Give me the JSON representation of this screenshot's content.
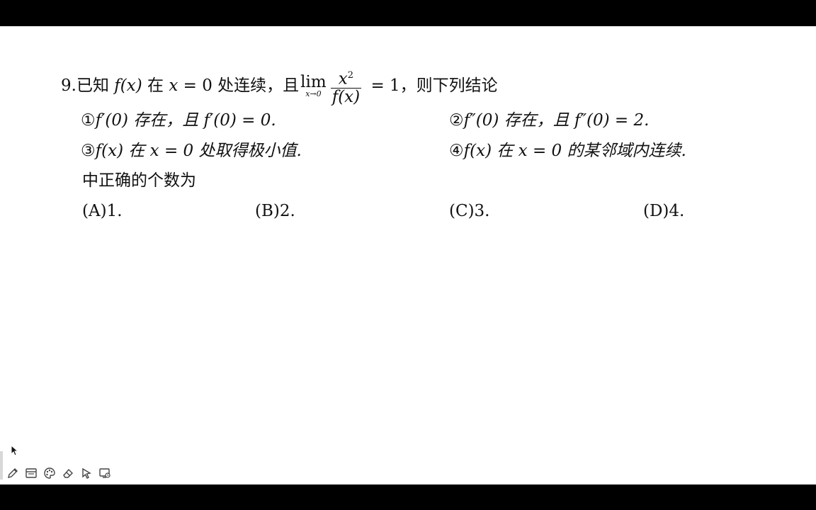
{
  "problem": {
    "number": "9.",
    "stem_1": "已知",
    "fx": "f(x)",
    "stem_2": "在",
    "cond_var": "x",
    "cond_eq": "= 0",
    "stem_3": "处连续，且",
    "lim_word": "lim",
    "lim_sub": "x→0",
    "frac_num": "x",
    "frac_num_exp": "2",
    "frac_den": "f(x)",
    "lim_value": "= 1",
    "stem_4": "，则下列结论"
  },
  "statements": [
    {
      "marker": "①",
      "text": "f′(0) 存在，且 f′(0) = 0."
    },
    {
      "marker": "②",
      "text": "f″(0) 存在，且 f″(0) = 2."
    },
    {
      "marker": "③",
      "text": "f(x) 在 x = 0 处取得极小值."
    },
    {
      "marker": "④",
      "text": "f(x) 在 x = 0 的某邻域内连续."
    }
  ],
  "question_tail": "中正确的个数为",
  "choices": [
    {
      "label": "(A)",
      "value": "1."
    },
    {
      "label": "(B)",
      "value": "2."
    },
    {
      "label": "(C)",
      "value": "3."
    },
    {
      "label": "(D)",
      "value": "4."
    }
  ],
  "toolbar": {
    "icons": [
      "pen-icon",
      "window-icon",
      "palette-icon",
      "eraser-icon",
      "pointer-icon",
      "screen-icon"
    ]
  },
  "colors": {
    "background": "#000000",
    "page": "#ffffff",
    "text": "#111111"
  }
}
